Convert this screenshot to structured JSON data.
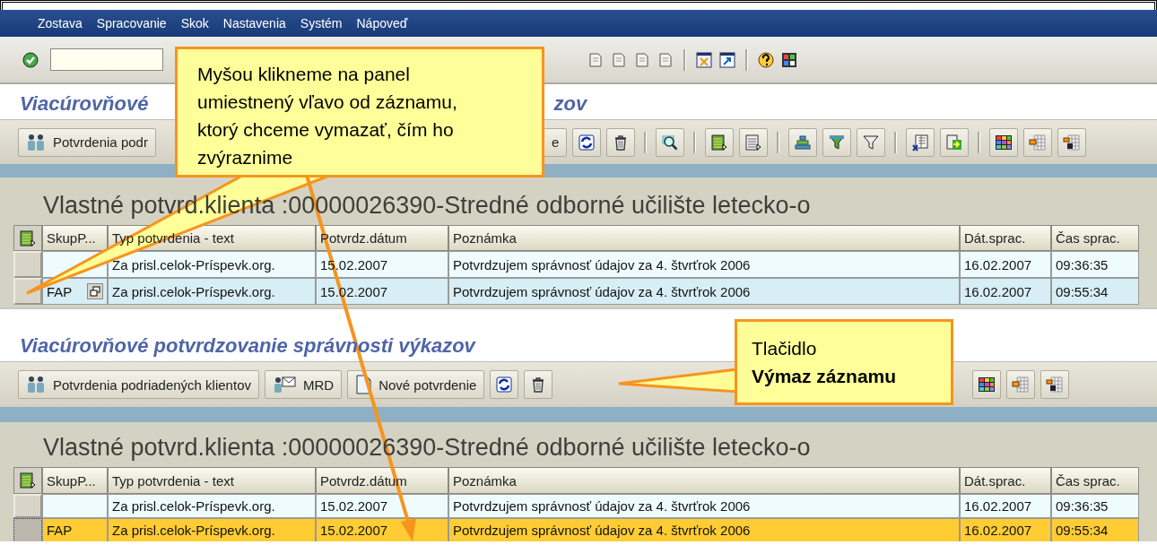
{
  "menu": [
    "Zostava",
    "Spracovanie",
    "Skok",
    "Nastavenia",
    "Systém",
    "Nápoveď"
  ],
  "screens": [
    {
      "title_parts": [
        "Viacúrovňové",
        "zov"
      ],
      "toolbar": [
        {
          "label": "Potvrdenia podr"
        },
        {
          "label": "e"
        }
      ],
      "table": {
        "title": "Vlastné potvrd.klienta :00000026390-Stredné odborné učilište letecko-o",
        "columns": [
          "SkupP...",
          "Typ potvrdenia - text",
          "Potvrdz.dátum",
          "Poznámka",
          "Dát.sprac.",
          "Čas sprac."
        ],
        "rows": [
          {
            "cells": [
              "",
              "Za prisl.celok-Príspevk.org.",
              "15.02.2007",
              "Potvrdzujem správnosť údajov za 4. štvrťrok 2006",
              "16.02.2007",
              "09:36:35"
            ],
            "selected": false,
            "value_help": false
          },
          {
            "cells": [
              "FAP",
              "Za prisl.celok-Príspevk.org.",
              "15.02.2007",
              "Potvrdzujem správnosť údajov za 4. štvrťrok 2006",
              "16.02.2007",
              "09:55:34"
            ],
            "selected": false,
            "value_help": true
          }
        ]
      }
    },
    {
      "title_parts": [
        "Viacúrovňové potvrdzovanie správnosti výkazov"
      ],
      "toolbar": [
        {
          "label": "Potvrdenia podriadených klientov"
        },
        {
          "label": "MRD"
        },
        {
          "label": "Nové potvrdenie"
        }
      ],
      "table": {
        "title": "Vlastné potvrd.klienta :00000026390-Stredné odborné učilište letecko-o",
        "columns": [
          "SkupP...",
          "Typ potvrdenia - text",
          "Potvrdz.dátum",
          "Poznámka",
          "Dát.sprac.",
          "Čas sprac."
        ],
        "rows": [
          {
            "cells": [
              "",
              "Za prisl.celok-Príspevk.org.",
              "15.02.2007",
              "Potvrdzujem správnosť údajov za 4. štvrťrok 2006",
              "16.02.2007",
              "09:36:35"
            ],
            "selected": false,
            "value_help": false
          },
          {
            "cells": [
              "FAP",
              "Za prisl.celok-Príspevk.org.",
              "15.02.2007",
              "Potvrdzujem správnosť údajov za 4. štvrťrok 2006",
              "16.02.2007",
              "09:55:34"
            ],
            "selected": true,
            "value_help": false
          }
        ]
      }
    }
  ],
  "callouts": [
    {
      "text": "Myšou klikneme na panel\numiestnený vľavo od záznamu,\nktorý chceme vymazať, čím ho\nzvýraznime"
    },
    {
      "text": "Tlačidlo\n**Výmaz záznamu**"
    }
  ]
}
